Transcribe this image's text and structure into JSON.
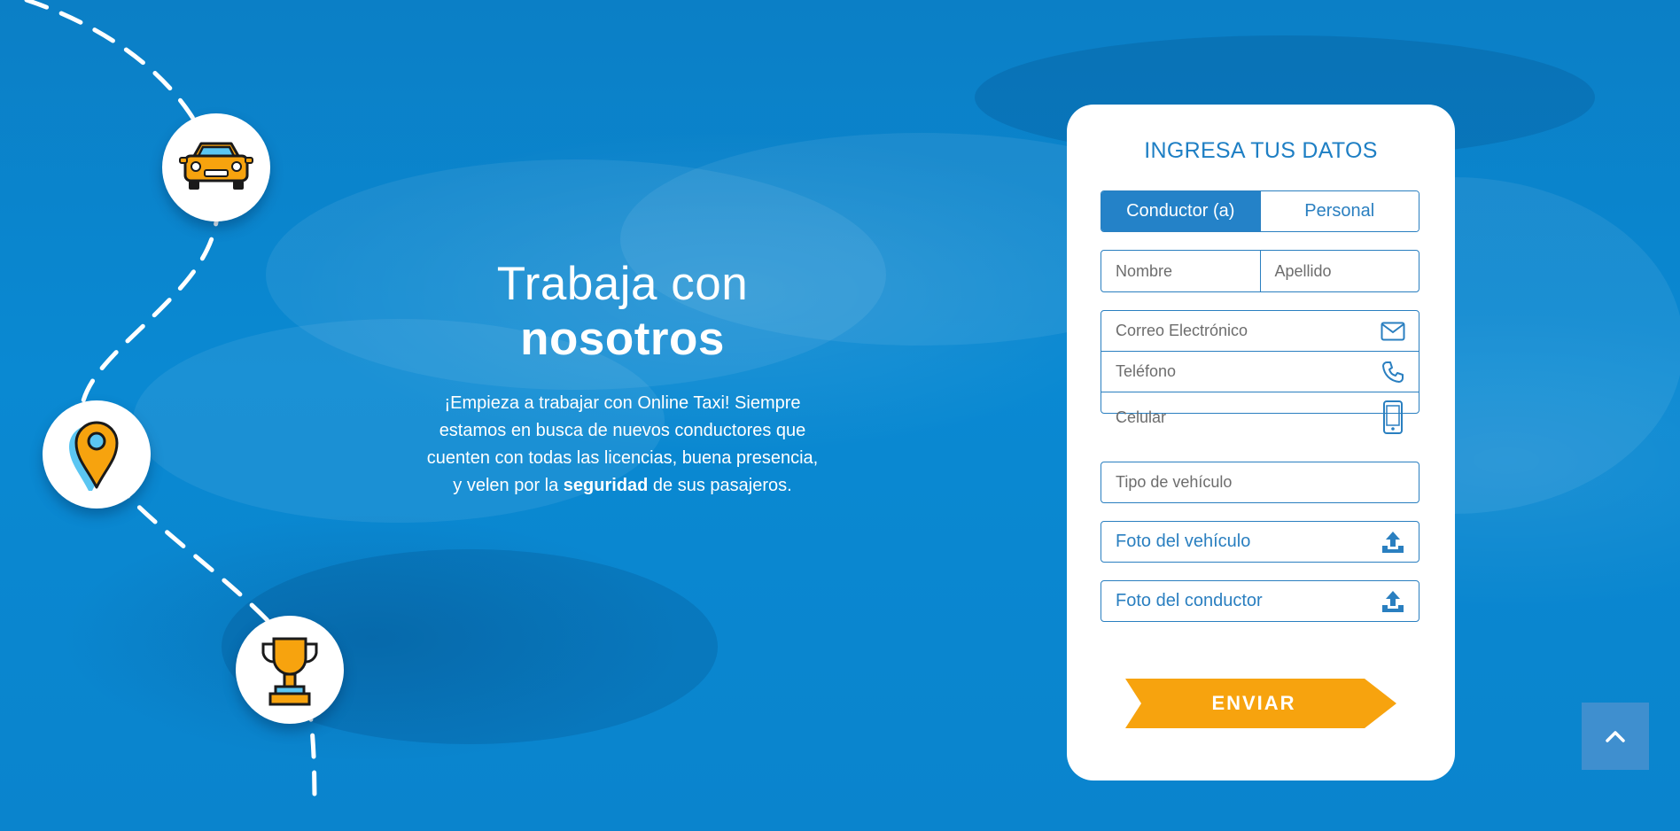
{
  "hero": {
    "title_line1": "Trabaja con",
    "title_line2": "nosotros",
    "paragraph_before": "¡Empieza a trabajar con Online Taxi! Siempre estamos en busca de nuevos conductores que cuenten con todas las licencias, buena presencia, y velen por la ",
    "paragraph_bold": "seguridad",
    "paragraph_after": " de sus pasajeros."
  },
  "form": {
    "title": "INGRESA TUS DATOS",
    "tabs": [
      {
        "label": "Conductor (a)",
        "active": true
      },
      {
        "label": "Personal",
        "active": false
      }
    ],
    "fields": {
      "first_name_placeholder": "Nombre",
      "last_name_placeholder": "Apellido",
      "email_placeholder": "Correo Electrónico",
      "phone_placeholder": "Teléfono",
      "mobile_placeholder": "Celular",
      "vehicle_type_placeholder": "Tipo de vehículo",
      "vehicle_photo_label": "Foto del vehículo",
      "driver_photo_label": "Foto del conductor"
    },
    "submit_label": "ENVIAR"
  },
  "route_icons": [
    "car-icon",
    "map-pin-icon",
    "trophy-icon"
  ],
  "scroll_top_icon": "chevron-up-icon",
  "colors": {
    "background": "#0a86d0",
    "accent_blue": "#2482c8",
    "accent_orange": "#f7a30e",
    "card": "#ffffff"
  }
}
